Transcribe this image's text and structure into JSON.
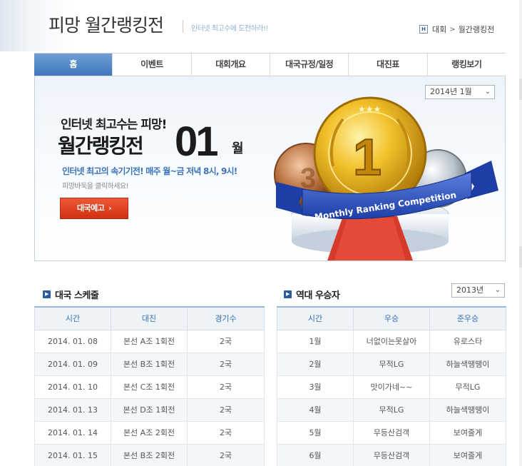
{
  "header": {
    "title": "피망 월간랭킹전",
    "subtitle": "인터넷 최고수에 도전하라!!",
    "breadcrumb": {
      "home_icon_text": "H",
      "parent": "대회",
      "current": "월간랭킹전"
    }
  },
  "tabs": [
    {
      "label": "홈",
      "active": true
    },
    {
      "label": "이벤트",
      "active": false
    },
    {
      "label": "대회개요",
      "active": false
    },
    {
      "label": "대국규정/일정",
      "active": false
    },
    {
      "label": "대진표",
      "active": false
    },
    {
      "label": "랭킹보기",
      "active": false
    }
  ],
  "banner": {
    "month_select": "2014년 1월",
    "line1": "인터넷 최고수는 피망!",
    "line2": "월간랭킹전",
    "month_number": "01",
    "month_unit": "월",
    "description": "인터넷 최고의 속기기전! 매주 월~금 저녁 8시, 9시!",
    "note": "피망바둑을 클릭하세요!",
    "preview_button": "대국예고",
    "preview_arrow": "›",
    "medal_number": "1",
    "ribbon_text": "Monthly Ranking Competition"
  },
  "schedule": {
    "title": "대국 스케줄",
    "columns": [
      "시간",
      "대진",
      "경기수"
    ],
    "rows": [
      [
        "2014. 01. 08",
        "본선 A조 1회전",
        "2국"
      ],
      [
        "2014. 01. 09",
        "본선 B조 1회전",
        "2국"
      ],
      [
        "2014. 01. 10",
        "본선 C조 1회전",
        "2국"
      ],
      [
        "2014. 01. 13",
        "본선 D조 1회전",
        "2국"
      ],
      [
        "2014. 01. 14",
        "본선 A조 2회전",
        "2국"
      ],
      [
        "2014. 01. 15",
        "본선 B조 2회전",
        "2국"
      ]
    ]
  },
  "winners": {
    "title": "역대 우승자",
    "year_select": "2013년",
    "columns": [
      "시간",
      "우승",
      "준우승"
    ],
    "rows": [
      [
        "1월",
        "너없이는못살아",
        "유로스타"
      ],
      [
        "2월",
        "무적LG",
        "하늘색땡땡이"
      ],
      [
        "3월",
        "맛이가네~~",
        "무적LG"
      ],
      [
        "4월",
        "무적LG",
        "하늘색땡땡이"
      ],
      [
        "5월",
        "무등산검객",
        "보여줄게"
      ],
      [
        "6월",
        "무등산검객",
        "보여줄게"
      ]
    ]
  },
  "colors": {
    "tab_active": "#4f86c6",
    "table_header_text": "#3a6fb0",
    "preview_button": "#e0431f",
    "accent_text": "#3d73b8"
  },
  "icons": {
    "home": "home-icon",
    "section": "section-bullet-icon",
    "select": "chevron-down-icon"
  }
}
